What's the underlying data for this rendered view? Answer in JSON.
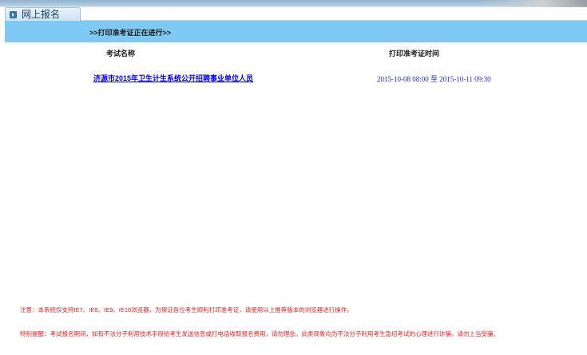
{
  "tab": {
    "label": "网上报名",
    "icon": "arrow-icon"
  },
  "status": {
    "text": ">>打印准考证正在进行>>"
  },
  "table": {
    "headers": [
      "考试名称",
      "打印准考证时间"
    ],
    "rows": [
      {
        "name": "济源市2015年卫生计生系统公开招聘事业单位人员",
        "time": "2015-10-08 08:00 至 2015-10-11 09:30"
      }
    ]
  },
  "notices": [
    "注意：本系统仅支持IE7、IE8、IE9、IE10浏览器，为保证各位考生顺利打印准考证，请使用以上推荐版本的浏览器进行操作。",
    "特别提醒：考试报名期间，如有不法分子利用技术手段给考生发送信息或打电话收取报名费用，请勿理会。此类现象均为不法分子利用考生急切考试的心理进行诈骗，请勿上当受骗。"
  ],
  "colors": {
    "status_bar": "#7fc9f5",
    "link": "#0000ee",
    "time": "#1f2bd6",
    "notice": "#e02020"
  }
}
